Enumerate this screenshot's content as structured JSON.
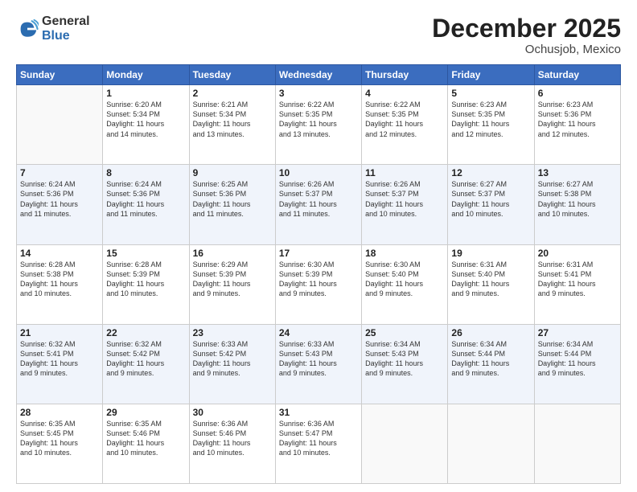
{
  "header": {
    "logo_general": "General",
    "logo_blue": "Blue",
    "month_title": "December 2025",
    "location": "Ochusjob, Mexico"
  },
  "days_of_week": [
    "Sunday",
    "Monday",
    "Tuesday",
    "Wednesday",
    "Thursday",
    "Friday",
    "Saturday"
  ],
  "weeks": [
    [
      {
        "day": "",
        "info": ""
      },
      {
        "day": "1",
        "info": "Sunrise: 6:20 AM\nSunset: 5:34 PM\nDaylight: 11 hours\nand 14 minutes."
      },
      {
        "day": "2",
        "info": "Sunrise: 6:21 AM\nSunset: 5:34 PM\nDaylight: 11 hours\nand 13 minutes."
      },
      {
        "day": "3",
        "info": "Sunrise: 6:22 AM\nSunset: 5:35 PM\nDaylight: 11 hours\nand 13 minutes."
      },
      {
        "day": "4",
        "info": "Sunrise: 6:22 AM\nSunset: 5:35 PM\nDaylight: 11 hours\nand 12 minutes."
      },
      {
        "day": "5",
        "info": "Sunrise: 6:23 AM\nSunset: 5:35 PM\nDaylight: 11 hours\nand 12 minutes."
      },
      {
        "day": "6",
        "info": "Sunrise: 6:23 AM\nSunset: 5:36 PM\nDaylight: 11 hours\nand 12 minutes."
      }
    ],
    [
      {
        "day": "7",
        "info": "Sunrise: 6:24 AM\nSunset: 5:36 PM\nDaylight: 11 hours\nand 11 minutes."
      },
      {
        "day": "8",
        "info": "Sunrise: 6:24 AM\nSunset: 5:36 PM\nDaylight: 11 hours\nand 11 minutes."
      },
      {
        "day": "9",
        "info": "Sunrise: 6:25 AM\nSunset: 5:36 PM\nDaylight: 11 hours\nand 11 minutes."
      },
      {
        "day": "10",
        "info": "Sunrise: 6:26 AM\nSunset: 5:37 PM\nDaylight: 11 hours\nand 11 minutes."
      },
      {
        "day": "11",
        "info": "Sunrise: 6:26 AM\nSunset: 5:37 PM\nDaylight: 11 hours\nand 10 minutes."
      },
      {
        "day": "12",
        "info": "Sunrise: 6:27 AM\nSunset: 5:37 PM\nDaylight: 11 hours\nand 10 minutes."
      },
      {
        "day": "13",
        "info": "Sunrise: 6:27 AM\nSunset: 5:38 PM\nDaylight: 11 hours\nand 10 minutes."
      }
    ],
    [
      {
        "day": "14",
        "info": "Sunrise: 6:28 AM\nSunset: 5:38 PM\nDaylight: 11 hours\nand 10 minutes."
      },
      {
        "day": "15",
        "info": "Sunrise: 6:28 AM\nSunset: 5:39 PM\nDaylight: 11 hours\nand 10 minutes."
      },
      {
        "day": "16",
        "info": "Sunrise: 6:29 AM\nSunset: 5:39 PM\nDaylight: 11 hours\nand 9 minutes."
      },
      {
        "day": "17",
        "info": "Sunrise: 6:30 AM\nSunset: 5:39 PM\nDaylight: 11 hours\nand 9 minutes."
      },
      {
        "day": "18",
        "info": "Sunrise: 6:30 AM\nSunset: 5:40 PM\nDaylight: 11 hours\nand 9 minutes."
      },
      {
        "day": "19",
        "info": "Sunrise: 6:31 AM\nSunset: 5:40 PM\nDaylight: 11 hours\nand 9 minutes."
      },
      {
        "day": "20",
        "info": "Sunrise: 6:31 AM\nSunset: 5:41 PM\nDaylight: 11 hours\nand 9 minutes."
      }
    ],
    [
      {
        "day": "21",
        "info": "Sunrise: 6:32 AM\nSunset: 5:41 PM\nDaylight: 11 hours\nand 9 minutes."
      },
      {
        "day": "22",
        "info": "Sunrise: 6:32 AM\nSunset: 5:42 PM\nDaylight: 11 hours\nand 9 minutes."
      },
      {
        "day": "23",
        "info": "Sunrise: 6:33 AM\nSunset: 5:42 PM\nDaylight: 11 hours\nand 9 minutes."
      },
      {
        "day": "24",
        "info": "Sunrise: 6:33 AM\nSunset: 5:43 PM\nDaylight: 11 hours\nand 9 minutes."
      },
      {
        "day": "25",
        "info": "Sunrise: 6:34 AM\nSunset: 5:43 PM\nDaylight: 11 hours\nand 9 minutes."
      },
      {
        "day": "26",
        "info": "Sunrise: 6:34 AM\nSunset: 5:44 PM\nDaylight: 11 hours\nand 9 minutes."
      },
      {
        "day": "27",
        "info": "Sunrise: 6:34 AM\nSunset: 5:44 PM\nDaylight: 11 hours\nand 9 minutes."
      }
    ],
    [
      {
        "day": "28",
        "info": "Sunrise: 6:35 AM\nSunset: 5:45 PM\nDaylight: 11 hours\nand 10 minutes."
      },
      {
        "day": "29",
        "info": "Sunrise: 6:35 AM\nSunset: 5:46 PM\nDaylight: 11 hours\nand 10 minutes."
      },
      {
        "day": "30",
        "info": "Sunrise: 6:36 AM\nSunset: 5:46 PM\nDaylight: 11 hours\nand 10 minutes."
      },
      {
        "day": "31",
        "info": "Sunrise: 6:36 AM\nSunset: 5:47 PM\nDaylight: 11 hours\nand 10 minutes."
      },
      {
        "day": "",
        "info": ""
      },
      {
        "day": "",
        "info": ""
      },
      {
        "day": "",
        "info": ""
      }
    ]
  ]
}
